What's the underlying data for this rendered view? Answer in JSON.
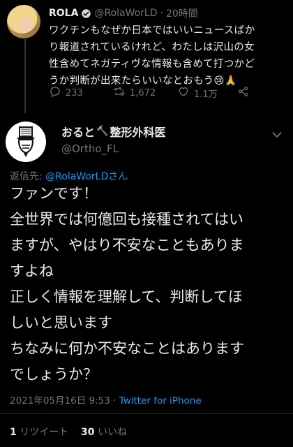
{
  "parent_tweet": {
    "name": "ROLA",
    "handle": "@RolaWorLD",
    "separator": "·",
    "time": "20時間",
    "text_lines": [
      "ワクチンもなぜか日本ではいいニュースばか",
      "り報道されているけれど、わたしは沢山の女",
      "性含めてネガティヴな情報も含めて打つかど",
      "うか判断が出来たらいいなとおもう😢🙏"
    ],
    "reply_count": "233",
    "retweet_count": "1,672",
    "like_count": "1.1万"
  },
  "reply_tweet": {
    "name": "おると",
    "name_suffix": "整形外科医",
    "name_emoji": "🔨",
    "handle": "@Ortho_FL",
    "reply_to_label": "返信先: ",
    "reply_to_handle": "@RolaWorLDさん",
    "body_lines": [
      "ファンです！",
      "全世界では何億回も接種されてはい",
      "ますが、やはり不安なこともありま",
      "すよね",
      "正しく情報を理解して、判断してほ",
      "しいと思います",
      "ちなみに何か不安なことはあります",
      "でしょうか？"
    ],
    "timestamp": "2021年05月16日 9:53 · ",
    "client": "Twitter for iPhone",
    "retweets_num": "1",
    "retweets_label": " リツイート",
    "likes_num": "30",
    "likes_label": " いいね"
  }
}
